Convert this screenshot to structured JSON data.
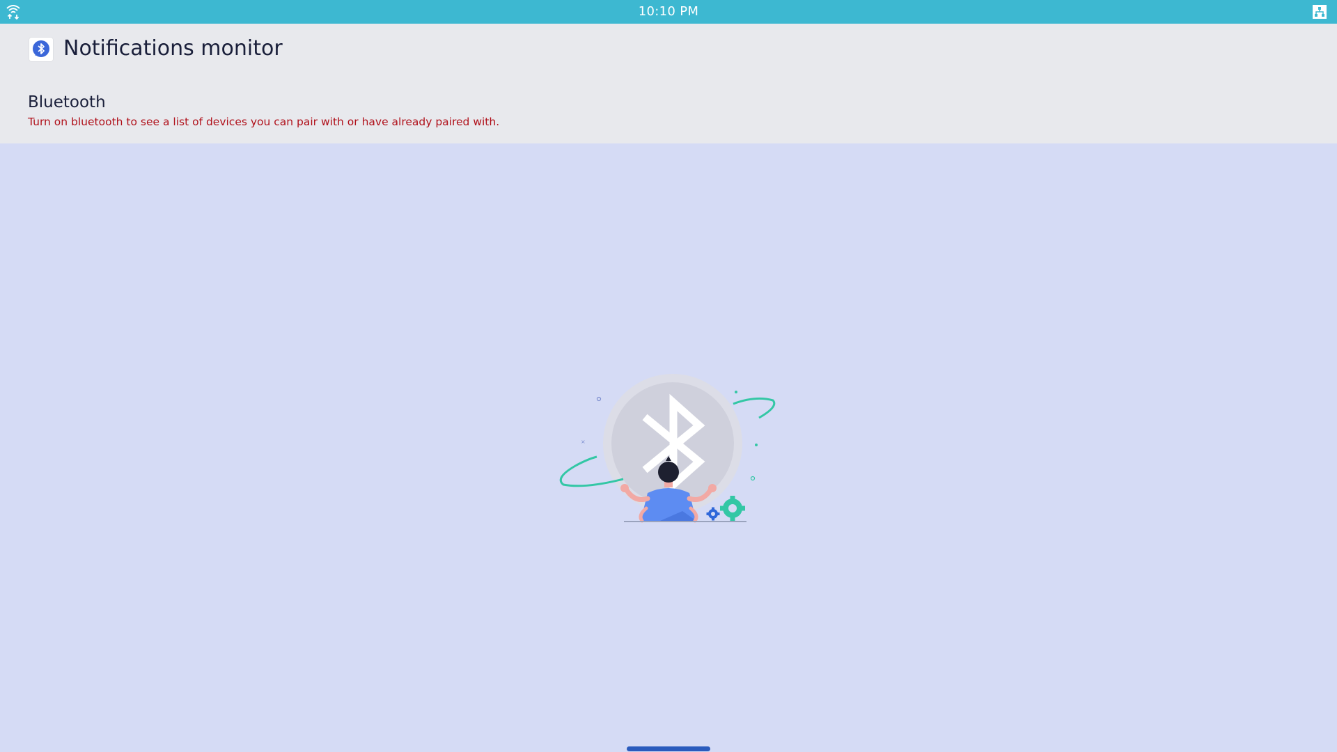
{
  "status_bar": {
    "time": "10:10 PM",
    "left_icon": "wifi-icon",
    "right_icon": "network-icon",
    "color": "#3db8d1"
  },
  "header": {
    "app_icon": "bluetooth-chat-icon",
    "app_title": "Notifications monitor",
    "section_title": "Bluetooth",
    "section_description": "Turn on bluetooth to see a list of devices you can pair with or have already paired with.",
    "description_color": "#b0101a"
  },
  "main": {
    "illustration": "bluetooth-off-person-illustration",
    "background": "#d5dbf5"
  },
  "navigation": {
    "home_indicator": "home-indicator"
  }
}
